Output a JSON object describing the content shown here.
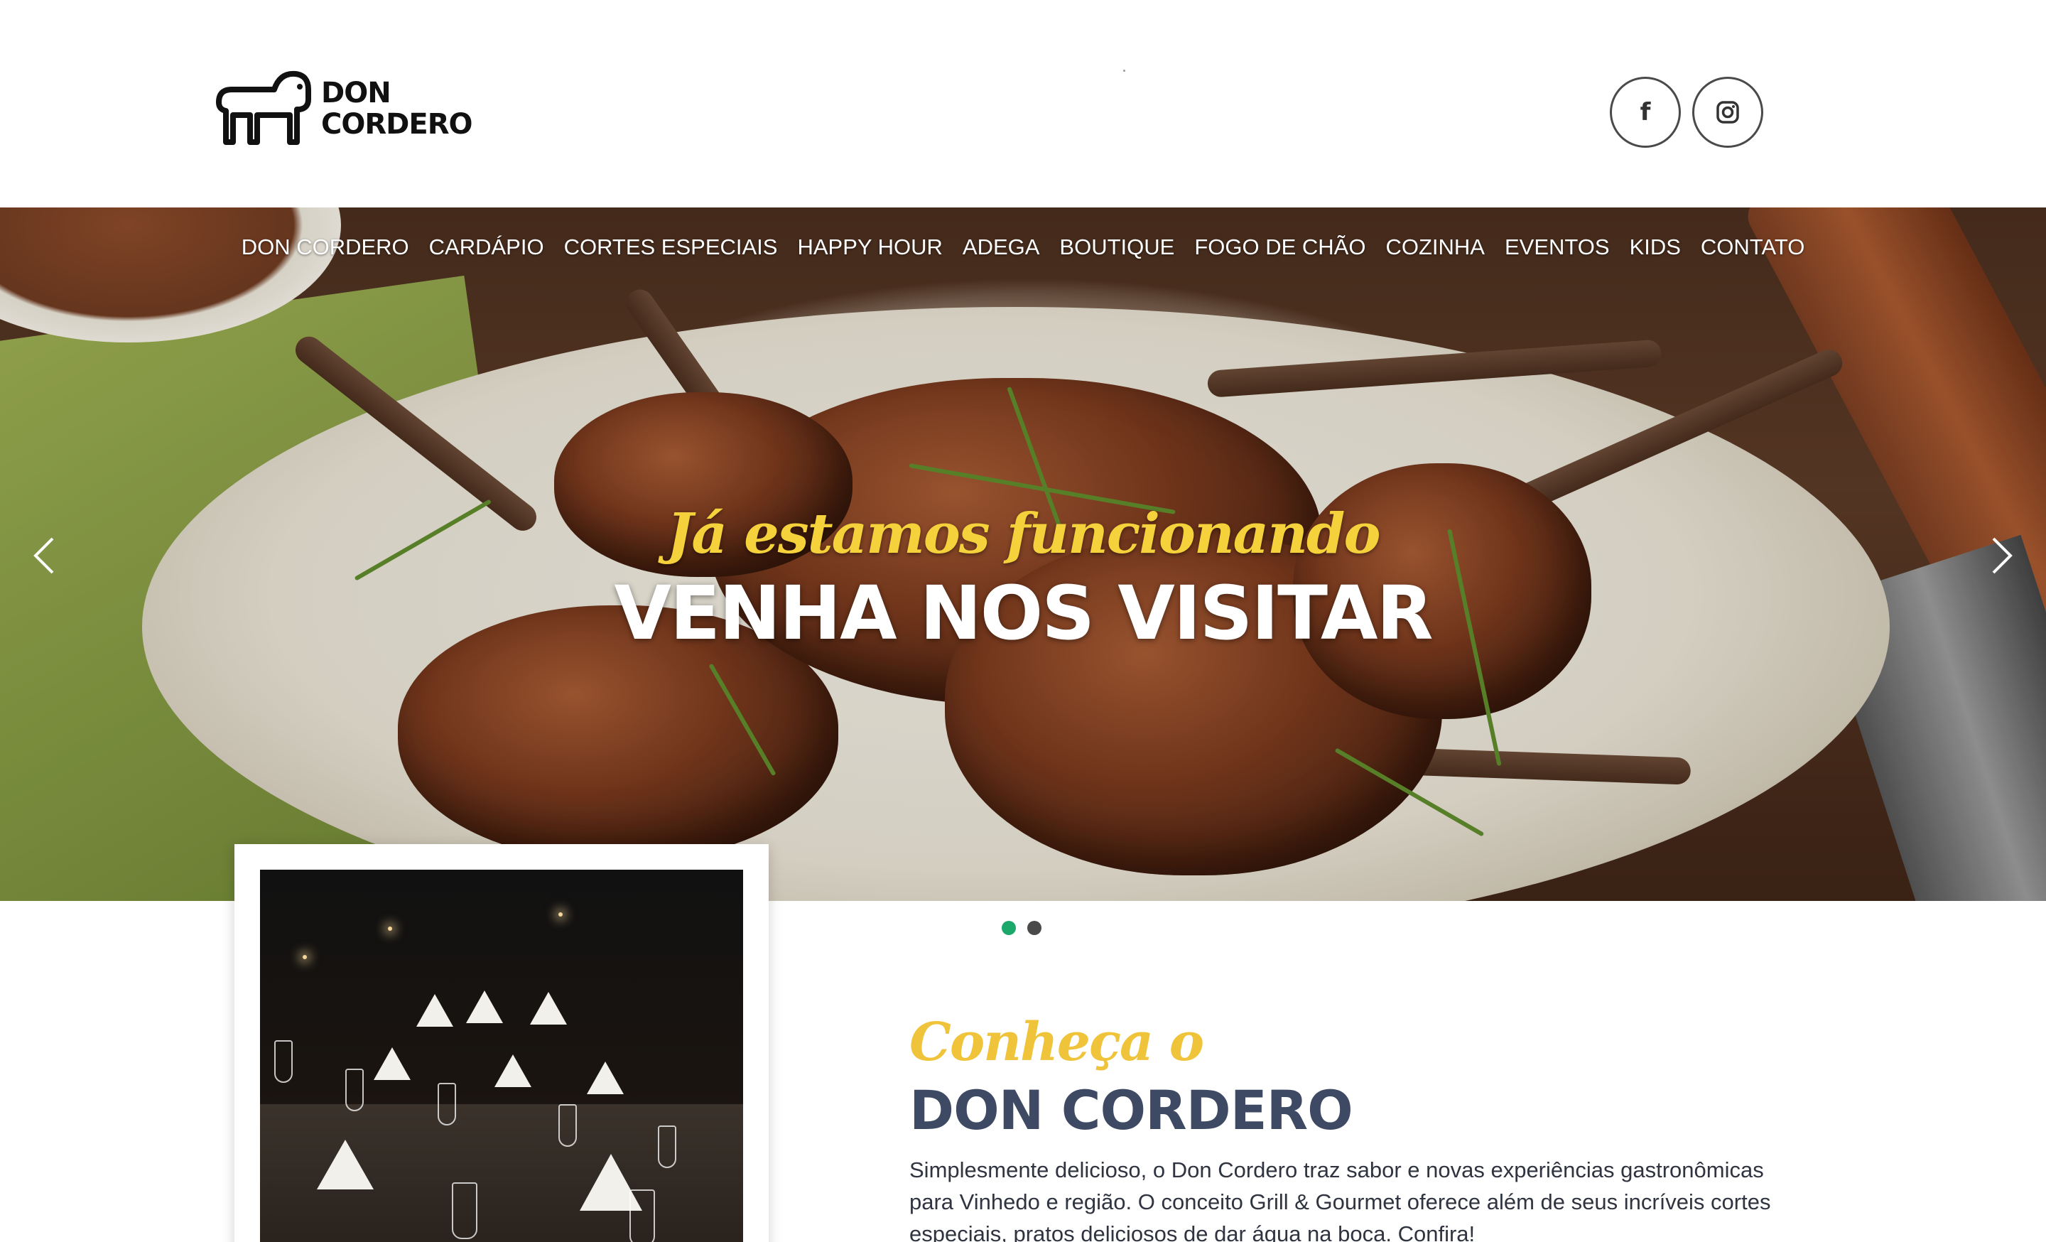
{
  "brand": {
    "line1": "DON",
    "line2": "CORDERO"
  },
  "social": {
    "facebook_glyph": "f",
    "instagram_icon": "instagram-icon"
  },
  "nav": {
    "items": [
      {
        "label": "DON CORDERO"
      },
      {
        "label": "CARDÁPIO"
      },
      {
        "label": "CORTES ESPECIAIS"
      },
      {
        "label": "HAPPY HOUR"
      },
      {
        "label": "ADEGA"
      },
      {
        "label": "BOUTIQUE"
      },
      {
        "label": "FOGO DE CHÃO"
      },
      {
        "label": "COZINHA"
      },
      {
        "label": "EVENTOS"
      },
      {
        "label": "KIDS"
      },
      {
        "label": "CONTATO"
      }
    ]
  },
  "hero": {
    "kicker": "Já estamos funcionando",
    "title": "VENHA NOS VISITAR",
    "active_slide": 1,
    "slide_count": 2
  },
  "intro": {
    "kicker": "Conheça o",
    "title": "DON CORDERO",
    "body": "Simplesmente delicioso, o Don Cordero traz sabor e novas experiências gastronômicas para Vinhedo e região. O conceito Grill & Gourmet oferece além de seus incríveis cortes especiais, pratos deliciosos de dar água na boca. Confira!"
  },
  "colors": {
    "accent_yellow": "#f5d23b",
    "heading_navy": "#3e4a63",
    "dot_active": "#1aa86b",
    "dot_inactive": "#4a4a4a"
  }
}
